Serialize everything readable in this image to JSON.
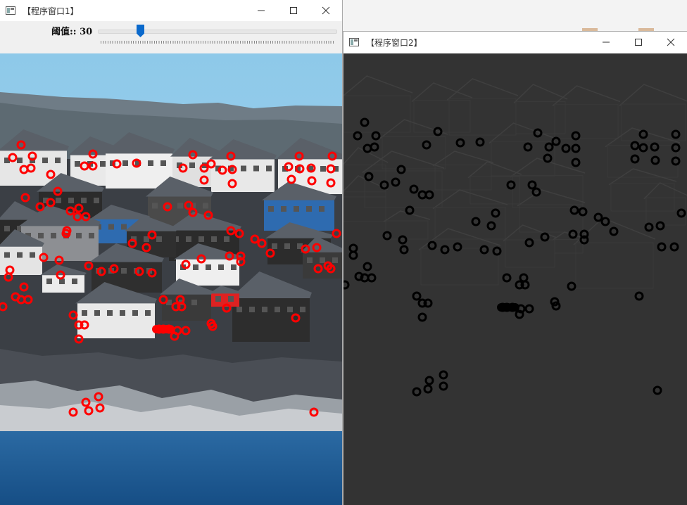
{
  "window1": {
    "title": "【程序窗口1】",
    "trackbar": {
      "label": "阈值:: 30",
      "value": 30
    }
  },
  "window2": {
    "title": "【程序窗口2】"
  },
  "colors": {
    "marker_window1": "#ff0000",
    "marker_window2": "#000000",
    "slider_thumb": "#0a69cc",
    "sky": "#8ec9e9",
    "sea": "#1e5f9a"
  },
  "icons": [
    "app-icon",
    "minimize-icon",
    "maximize-icon",
    "close-icon"
  ]
}
